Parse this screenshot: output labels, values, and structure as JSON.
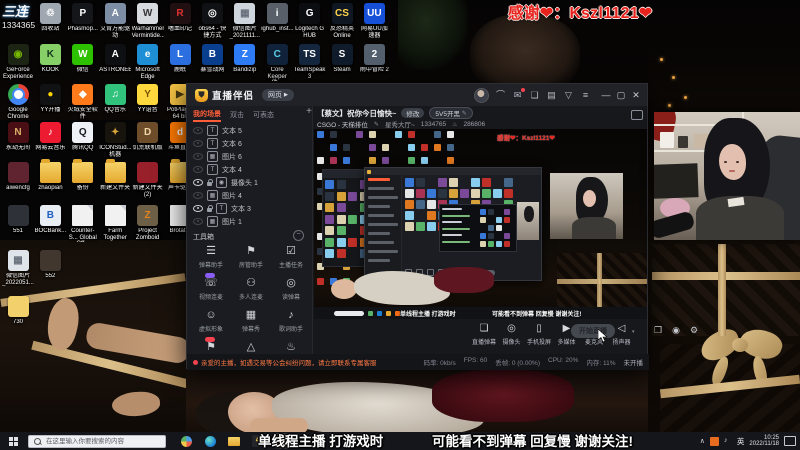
{
  "overlay": {
    "thanks_text": "感谢❤：Kszl1121❤",
    "badge_title": "三连",
    "badge_value": "1334365",
    "taskbar_text_left": "单线程主播 打游戏时",
    "taskbar_text_right": "可能看不到弹幕 回复慢 谢谢关注!"
  },
  "desktop": {
    "rows": [
      {
        "offset": 1,
        "items": [
          {
            "label": "回收站",
            "c": "#9fa8b0",
            "g": "♲"
          },
          {
            "label": "Phasmop...",
            "c": "#15161a",
            "g": "P"
          },
          {
            "label": "艾肯万能驱动",
            "c": "#7d8da3",
            "g": "A"
          },
          {
            "label": "Warhammer Vermintide...",
            "c": "#d7dade",
            "g": "W",
            "gc": "#333333"
          },
          {
            "label": "嗜血印记",
            "c": "#201012",
            "g": "R",
            "gc": "#e03030"
          },
          {
            "label": "obs64 - 快捷方式",
            "c": "#101114",
            "g": "◎"
          },
          {
            "label": "微信图片_2021111...",
            "c": "#cfd5dc",
            "g": "▦",
            "gc": "#67707c"
          },
          {
            "label": "ighub_inst...",
            "c": "#585f68",
            "g": "i"
          },
          {
            "label": "Logitech G HUB",
            "c": "#0c0d10",
            "g": "G"
          },
          {
            "label": "反恐精英 Online",
            "c": "#0f1822",
            "g": "CS",
            "gc": "#ffd24a"
          },
          {
            "label": "网易UU加速器",
            "c": "#1650d8",
            "g": "UU"
          }
        ]
      },
      {
        "items": [
          {
            "label": "GeForce Experience",
            "c": "#1c2414",
            "g": "◉",
            "gc": "#76b900"
          },
          {
            "label": "KOOK",
            "c": "#87d068",
            "g": "K",
            "gc": "#15361f"
          },
          {
            "label": "微信",
            "c": "#2dc100",
            "g": "W"
          },
          {
            "label": "ASTRONEER",
            "c": "#0e0f12",
            "g": "A"
          },
          {
            "label": "Microsoft Edge",
            "c": "#1e8fd5",
            "g": "e"
          },
          {
            "label": "鹿眠",
            "c": "#2b6fe0",
            "g": "L"
          },
          {
            "label": "暴雪战网",
            "c": "#0a3f8f",
            "g": "B"
          },
          {
            "label": "Bandizip",
            "c": "#2f7df6",
            "g": "Z"
          },
          {
            "label": "Core Keeper 他...",
            "c": "#10233a",
            "g": "C",
            "gc": "#5ad0e8"
          },
          {
            "label": "TeamSpeak 3",
            "c": "#14273f",
            "g": "TS"
          },
          {
            "label": "Steam",
            "c": "#101b2b",
            "g": "S"
          },
          {
            "label": "雨中冒险 2",
            "c": "#55606e",
            "g": "2"
          }
        ]
      },
      {
        "items": [
          {
            "label": "Google Chrome",
            "kind": "chrome"
          },
          {
            "label": "YY开播",
            "c": "#111214",
            "g": "●",
            "gc": "#ffd400"
          },
          {
            "label": "火绒安全软件",
            "c": "#ff7a1a",
            "g": "◆"
          },
          {
            "label": "QQ音乐",
            "c": "#31c27c",
            "g": "♫"
          },
          {
            "label": "YY语音",
            "c": "#ffd83d",
            "g": "Y",
            "gc": "#7a5200"
          },
          {
            "label": "PotPlayer 64 bit",
            "c": "#f6c344",
            "g": "▶",
            "gc": "#4a3a10"
          }
        ]
      },
      {
        "items": [
          {
            "label": "永劫无间",
            "c": "#4a0f14",
            "g": "N",
            "gc": "#d8b068"
          },
          {
            "label": "网易云音乐",
            "c": "#ec1b32",
            "g": "♪"
          },
          {
            "label": "腾讯QQ",
            "c": "#eef2f6",
            "g": "Q",
            "gc": "#15181d"
          },
          {
            "label": "ICONStud... 机器",
            "c": "#17140e",
            "g": "✦",
            "gc": "#d8a23a"
          },
          {
            "label": "饥荒联机版",
            "c": "#6e4d2a",
            "g": "D",
            "gc": "#f0d9a8"
          },
          {
            "label": "斗鱼直播",
            "c": "#ff7b00",
            "g": "d"
          }
        ]
      },
      {
        "items": [
          {
            "label": "aiwencfg",
            "c": "#5f2430",
            "g": ""
          },
          {
            "label": "zhaopian",
            "kind": "folder"
          },
          {
            "label": "备份",
            "kind": "folder"
          },
          {
            "label": "新建文件夹",
            "kind": "folder"
          },
          {
            "label": "新建文件夹 (2)",
            "c": "#97202a",
            "g": ""
          },
          {
            "label": "声卡驱动",
            "kind": "folder"
          }
        ]
      },
      {
        "items": [
          {
            "label": "551",
            "c": "#2e3238",
            "g": ""
          },
          {
            "label": "BOCBank...",
            "c": "#e9eef4",
            "g": "B",
            "gc": "#1f5fc2"
          },
          {
            "label": "Counter-S... Global Off...",
            "kind": "doc"
          },
          {
            "label": "Farm Together",
            "kind": "doc"
          },
          {
            "label": "Project Zomboid",
            "c": "#6e6046",
            "g": "Z",
            "gc": "#e0851f"
          },
          {
            "label": "Brotat...",
            "kind": "doc"
          }
        ]
      },
      {
        "items": [
          {
            "label": "微信图片_2022051...",
            "c": "#dfe4ea",
            "g": "▦",
            "gc": "#67707c"
          },
          {
            "label": "552",
            "c": "#41372f",
            "g": ""
          }
        ]
      },
      {
        "items": [
          {
            "label": "730",
            "c": "#f2d06b",
            "g": ""
          }
        ]
      }
    ]
  },
  "app": {
    "logo_text": "直播伴侣",
    "web_button": "网页",
    "titlebar_icons": [
      "headset",
      "mail",
      "chat",
      "card",
      "filter",
      "menu"
    ],
    "window_controls": [
      "minimize",
      "maximize",
      "close"
    ],
    "window_glyphs": {
      "minimize": "—",
      "maximize": "▢",
      "close": "✕"
    },
    "header": {
      "title": "【蔡文】祝你今日愉快~",
      "edit_button": "修改",
      "tag": "5V5开黑",
      "tag_edit_icon": "✎",
      "category": "CSGO - 天梯排位",
      "category_edit_icon": "✎",
      "hall": "星秀大厅~",
      "stat_viewers": "1334765",
      "stat_hot": "286806",
      "stat_hot_icon": "♨"
    },
    "tabs": [
      {
        "label": "我的场景",
        "active": true
      },
      {
        "label": "双击",
        "active": false
      },
      {
        "label": "可表态",
        "active": false
      }
    ],
    "add_tab": "+",
    "sources": [
      {
        "g": "T",
        "label": "文本 5",
        "vis": false,
        "lock": false
      },
      {
        "g": "T",
        "label": "文本 6",
        "vis": false,
        "lock": false
      },
      {
        "g": "▦",
        "label": "图片 6",
        "vis": false,
        "lock": false
      },
      {
        "g": "T",
        "label": "文本 4",
        "vis": false,
        "lock": false
      },
      {
        "g": "◉",
        "label": "摄像头 1",
        "vis": true,
        "lock": true
      },
      {
        "g": "▦",
        "label": "图片 4",
        "vis": false,
        "lock": false
      },
      {
        "g": "T",
        "label": "文本 3",
        "vis": true,
        "lock": true
      },
      {
        "g": "▦",
        "label": "图片 1",
        "vis": false,
        "lock": false
      }
    ],
    "toolbox_title": "工具箱",
    "tools": [
      {
        "label": "弹幕助手",
        "g": "☰"
      },
      {
        "label": "房管助手",
        "g": "⚑"
      },
      {
        "label": "主播任务",
        "g": "☑"
      },
      {
        "label": "视频连麦",
        "g": "☏",
        "badge": "#8a5cf6"
      },
      {
        "label": "多人连麦",
        "g": "⚇"
      },
      {
        "label": "读弹幕",
        "g": "◎"
      },
      {
        "label": "虚拟形象",
        "g": "☺"
      },
      {
        "label": "弹幕秀",
        "g": "▦"
      },
      {
        "label": "歌词助手",
        "g": "♪"
      },
      {
        "label": "",
        "g": "⚑",
        "badge": "#f5424e"
      },
      {
        "label": "",
        "g": "△"
      },
      {
        "label": "",
        "g": "♨"
      }
    ],
    "controls": [
      {
        "label": "直播弹幕",
        "icon": "danmaku",
        "g": "❏"
      },
      {
        "label": "摄像头",
        "icon": "camera",
        "g": "◎"
      },
      {
        "label": "手机投屏",
        "icon": "phone",
        "g": "▯"
      },
      {
        "label": "多媒体",
        "icon": "media",
        "g": "▶"
      },
      {
        "label": "麦克风",
        "icon": "mic",
        "g": "♦",
        "dd": true
      },
      {
        "label": "扬声器",
        "icon": "speaker",
        "g": "◁",
        "dd": true
      }
    ],
    "extra_controls": [
      {
        "icon": "pip",
        "g": "❐"
      },
      {
        "icon": "record",
        "g": "◉"
      },
      {
        "icon": "settings",
        "g": "⚙"
      }
    ],
    "action_button": "开始直播",
    "status": [
      "码率: 0kb/s",
      "FPS: 60",
      "丢帧: 0 (0.00%)",
      "CPU: 20%",
      "内存: 11%",
      "未开播"
    ],
    "notice": "亲爱的主播，如遇交易等公会纠纷问题，请立即联系专属客服"
  },
  "preview": {
    "mini_thanks": "感谢❤：Kszl1121❤",
    "mini_text_left": "单线程主播 打游戏时",
    "mini_text_right": "可能看不到弹幕 回复慢 谢谢关注!",
    "tile_palette": [
      "#d8a23a",
      "#c03028",
      "#3a78d8",
      "#58b368",
      "#e6e6e6",
      "#7a4a98",
      "#e07820",
      "#2a3340",
      "#88ccee",
      "#aa3355",
      "#ddd2b0",
      "#446688"
    ]
  },
  "taskbar": {
    "search_placeholder": "在这里输入你要搜索的内容",
    "icons": [
      "widgets",
      "edge",
      "explorer",
      "lightning",
      "live-companion"
    ],
    "tray": {
      "lang": "英",
      "time": "10:25",
      "date": "2022/11/18"
    }
  },
  "colors": {
    "accent": "#ff5c38",
    "thanks_red": "#e8231d",
    "notice_orange": "#ff7a45"
  }
}
